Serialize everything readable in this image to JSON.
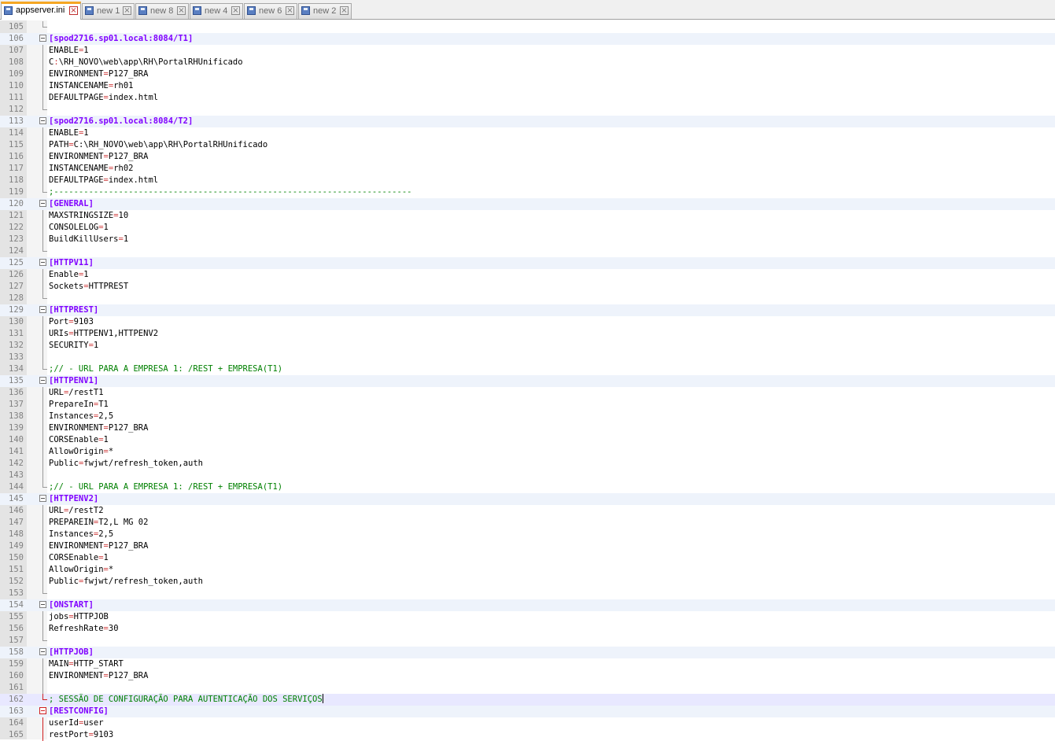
{
  "tabs": [
    {
      "label": "appserver.ini",
      "active": true
    },
    {
      "label": "new 1",
      "active": false
    },
    {
      "label": "new 8",
      "active": false
    },
    {
      "label": "new 4",
      "active": false
    },
    {
      "label": "new 6",
      "active": false
    },
    {
      "label": "new 2",
      "active": false
    }
  ],
  "lines": [
    {
      "n": "105",
      "t": ""
    },
    {
      "n": "106",
      "t": "[spod2716.sp01.local:8084/T1]"
    },
    {
      "n": "107",
      "t": "ENABLE=1"
    },
    {
      "n": "108",
      "t": "C:\\RH_NOVO\\web\\app\\RH\\PortalRHUnificado"
    },
    {
      "n": "109",
      "t": "ENVIRONMENT=P127_BRA"
    },
    {
      "n": "110",
      "t": "INSTANCENAME=rh01"
    },
    {
      "n": "111",
      "t": "DEFAULTPAGE=index.html"
    },
    {
      "n": "112",
      "t": ""
    },
    {
      "n": "113",
      "t": "[spod2716.sp01.local:8084/T2]"
    },
    {
      "n": "114",
      "t": "ENABLE=1"
    },
    {
      "n": "115",
      "t": "PATH=C:\\RH_NOVO\\web\\app\\RH\\PortalRHUnificado"
    },
    {
      "n": "116",
      "t": "ENVIRONMENT=P127_BRA"
    },
    {
      "n": "117",
      "t": "INSTANCENAME=rh02"
    },
    {
      "n": "118",
      "t": "DEFAULTPAGE=index.html"
    },
    {
      "n": "119",
      "t": ";------------------------------------------------------------------------"
    },
    {
      "n": "120",
      "t": "[GENERAL]"
    },
    {
      "n": "121",
      "t": "MAXSTRINGSIZE=10"
    },
    {
      "n": "122",
      "t": "CONSOLELOG=1"
    },
    {
      "n": "123",
      "t": "BuildKillUsers=1"
    },
    {
      "n": "124",
      "t": ""
    },
    {
      "n": "125",
      "t": "[HTTPV11]"
    },
    {
      "n": "126",
      "t": "Enable=1"
    },
    {
      "n": "127",
      "t": "Sockets=HTTPREST"
    },
    {
      "n": "128",
      "t": ""
    },
    {
      "n": "129",
      "t": "[HTTPREST]"
    },
    {
      "n": "130",
      "t": "Port=9103"
    },
    {
      "n": "131",
      "t": "URIs=HTTPENV1,HTTPENV2"
    },
    {
      "n": "132",
      "t": "SECURITY=1"
    },
    {
      "n": "133",
      "t": ""
    },
    {
      "n": "134",
      "t": ";// - URL PARA A EMPRESA 1: /REST + EMPRESA(T1)"
    },
    {
      "n": "135",
      "t": "[HTTPENV1]"
    },
    {
      "n": "136",
      "t": "URL=/restT1"
    },
    {
      "n": "137",
      "t": "PrepareIn=T1"
    },
    {
      "n": "138",
      "t": "Instances=2,5"
    },
    {
      "n": "139",
      "t": "ENVIRONMENT=P127_BRA"
    },
    {
      "n": "140",
      "t": "CORSEnable=1"
    },
    {
      "n": "141",
      "t": "AllowOrigin=*"
    },
    {
      "n": "142",
      "t": "Public=fwjwt/refresh_token,auth"
    },
    {
      "n": "143",
      "t": ""
    },
    {
      "n": "144",
      "t": ";// - URL PARA A EMPRESA 1: /REST + EMPRESA(T1)"
    },
    {
      "n": "145",
      "t": "[HTTPENV2]"
    },
    {
      "n": "146",
      "t": "URL=/restT2"
    },
    {
      "n": "147",
      "t": "PREPAREIN=T2,L MG 02"
    },
    {
      "n": "148",
      "t": "Instances=2,5"
    },
    {
      "n": "149",
      "t": "ENVIRONMENT=P127_BRA"
    },
    {
      "n": "150",
      "t": "CORSEnable=1"
    },
    {
      "n": "151",
      "t": "AllowOrigin=*"
    },
    {
      "n": "152",
      "t": "Public=fwjwt/refresh_token,auth"
    },
    {
      "n": "153",
      "t": ""
    },
    {
      "n": "154",
      "t": "[ONSTART]"
    },
    {
      "n": "155",
      "t": "jobs=HTTPJOB"
    },
    {
      "n": "156",
      "t": "RefreshRate=30"
    },
    {
      "n": "157",
      "t": ""
    },
    {
      "n": "158",
      "t": "[HTTPJOB]"
    },
    {
      "n": "159",
      "t": "MAIN=HTTP_START"
    },
    {
      "n": "160",
      "t": "ENVIRONMENT=P127_BRA"
    },
    {
      "n": "161",
      "t": ""
    },
    {
      "n": "162",
      "t": "; SESSÃO DE CONFIGURAÇÃO PARA AUTENTICAÇÃO DOS SERVIÇOS"
    },
    {
      "n": "163",
      "t": "[RESTCONFIG]"
    },
    {
      "n": "164",
      "t": "userId=user"
    },
    {
      "n": "165",
      "t": "restPort=9103"
    }
  ],
  "colors": {
    "section": "#8000ff",
    "operator": "#d04040",
    "comment": "#008000",
    "active_tab_accent": "#f5a623",
    "fold_active": "#d02020"
  }
}
